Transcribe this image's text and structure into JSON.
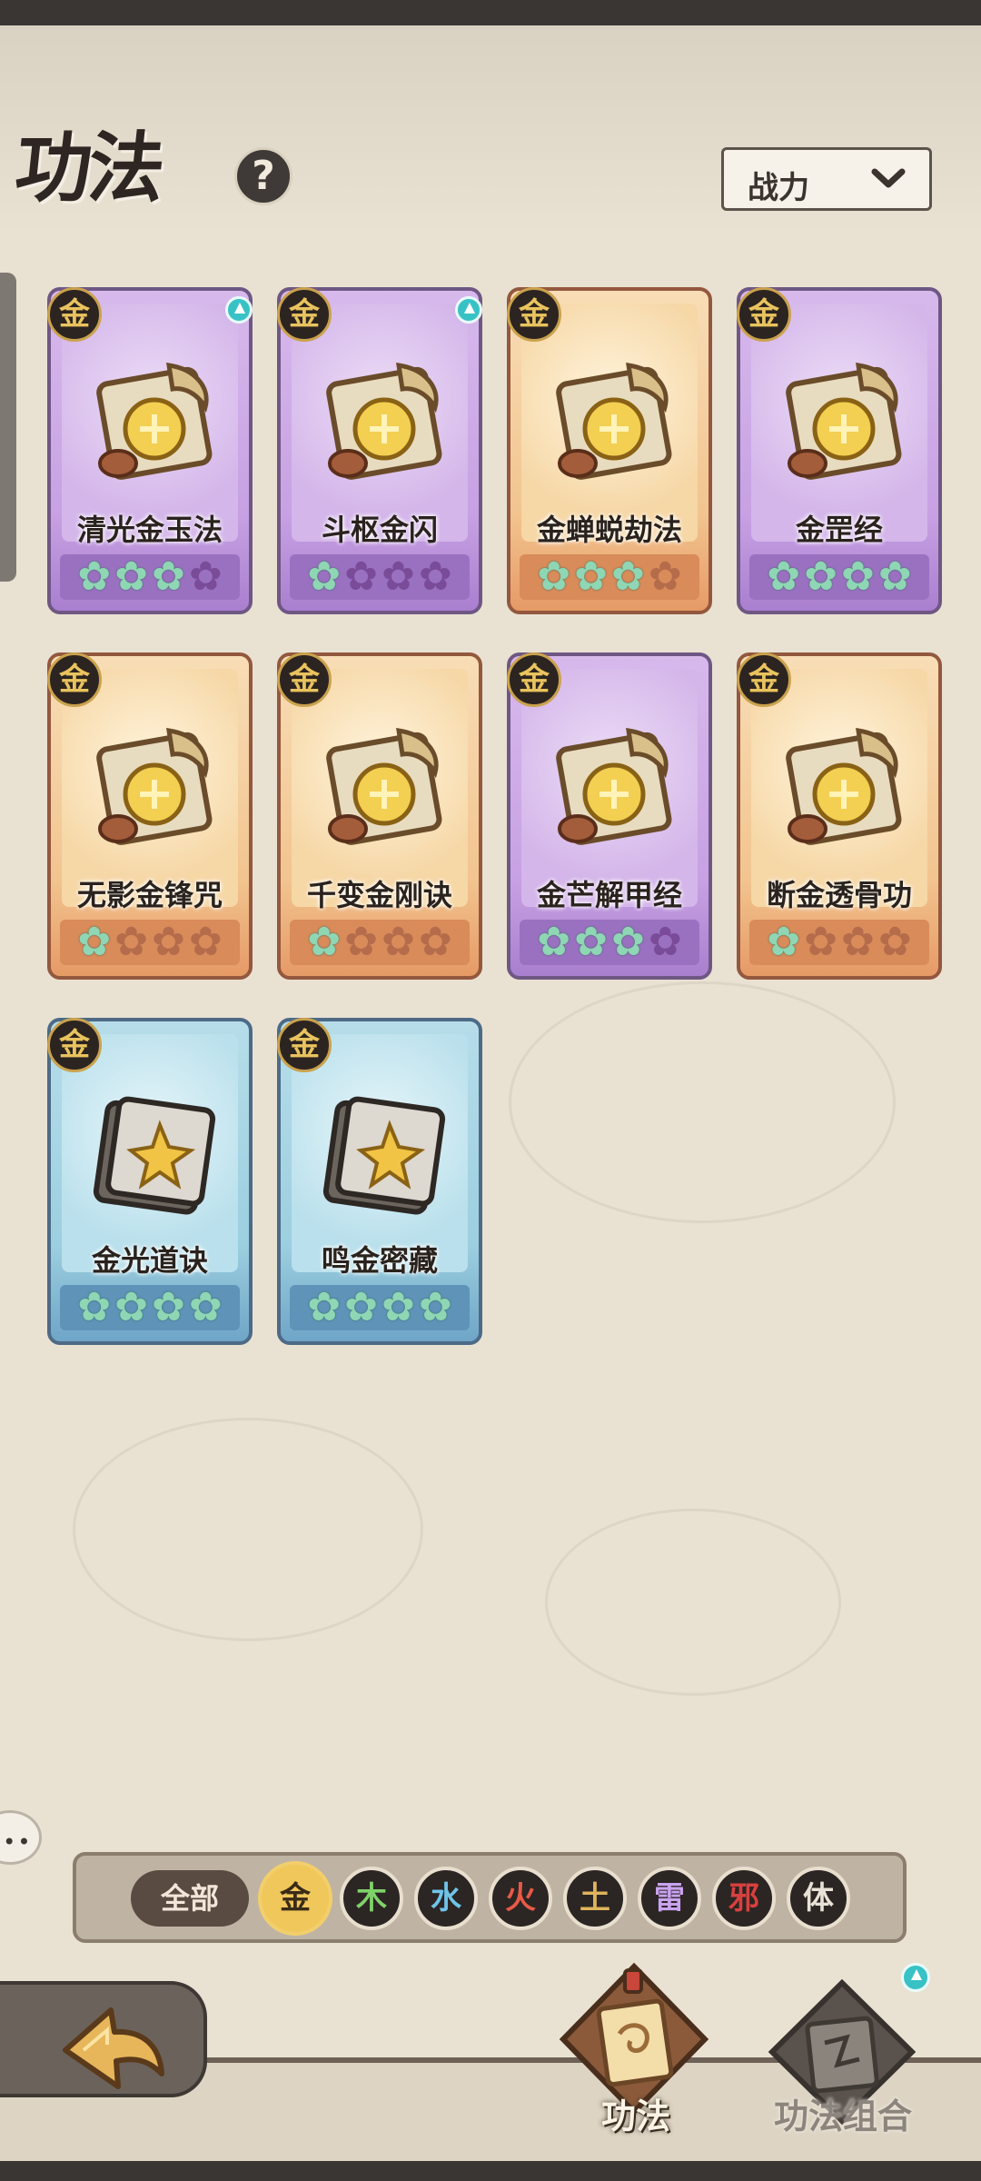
{
  "header": {
    "title": "功法",
    "help_icon": "?",
    "sort_label": "战力"
  },
  "cards": [
    {
      "name": "清光金玉法",
      "element": "金",
      "rarity": "purple",
      "stars_lit": 3,
      "stars_total": 4,
      "upgrade": true,
      "icon": "gold-coin-icon"
    },
    {
      "name": "斗枢金闪",
      "element": "金",
      "rarity": "purple",
      "stars_lit": 1,
      "stars_total": 4,
      "upgrade": true,
      "icon": "gold-sword-icon"
    },
    {
      "name": "金蝉蜕劫法",
      "element": "金",
      "rarity": "orange",
      "stars_lit": 3,
      "stars_total": 4,
      "upgrade": false,
      "icon": "cicada-icon"
    },
    {
      "name": "金罡经",
      "element": "金",
      "rarity": "purple",
      "stars_lit": 4,
      "stars_total": 4,
      "upgrade": false,
      "icon": "gold-stairs-icon"
    },
    {
      "name": "无影金锋咒",
      "element": "金",
      "rarity": "orange",
      "stars_lit": 1,
      "stars_total": 4,
      "upgrade": false,
      "icon": "blade-icon"
    },
    {
      "name": "千变金刚诀",
      "element": "金",
      "rarity": "orange",
      "stars_lit": 1,
      "stars_total": 4,
      "upgrade": false,
      "icon": "gold-shell-icon"
    },
    {
      "name": "金芒解甲经",
      "element": "金",
      "rarity": "purple",
      "stars_lit": 3,
      "stars_total": 4,
      "upgrade": false,
      "icon": "gold-pillar-icon"
    },
    {
      "name": "断金透骨功",
      "element": "金",
      "rarity": "orange",
      "stars_lit": 1,
      "stars_total": 4,
      "upgrade": false,
      "icon": "broken-ingot-icon"
    },
    {
      "name": "金光道诀",
      "element": "金",
      "rarity": "blue",
      "stars_lit": 4,
      "stars_total": 4,
      "upgrade": false,
      "icon": "book-starburst-icon"
    },
    {
      "name": "鸣金密藏",
      "element": "金",
      "rarity": "blue",
      "stars_lit": 4,
      "stars_total": 4,
      "upgrade": false,
      "icon": "book-shield-icon"
    }
  ],
  "filter": {
    "all_label": "全部",
    "elements": [
      {
        "label": "金",
        "color": "#f0c75a",
        "active": true
      },
      {
        "label": "木",
        "color": "#7fd26a",
        "active": false
      },
      {
        "label": "水",
        "color": "#6fc4e8",
        "active": false
      },
      {
        "label": "火",
        "color": "#e65a48",
        "active": false
      },
      {
        "label": "土",
        "color": "#e0b45c",
        "active": false
      },
      {
        "label": "雷",
        "color": "#c9a3f0",
        "active": false
      },
      {
        "label": "邪",
        "color": "#d8403e",
        "active": false
      },
      {
        "label": "体",
        "color": "#e8e2d6",
        "active": false
      }
    ]
  },
  "bottom_nav": {
    "tab_gongfa": "功法",
    "tab_combo": "功法组合",
    "combo_upgrade": true
  },
  "colors": {
    "background": "#e9e2d3",
    "gold": "#f0c75a",
    "star_lit": "#8fd6b4"
  }
}
